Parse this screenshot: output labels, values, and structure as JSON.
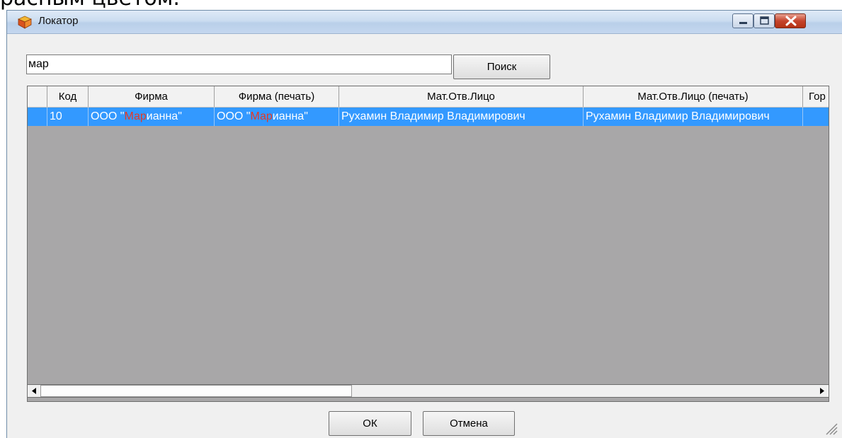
{
  "background_caption": "расным цветом.",
  "window": {
    "title": "Локатор",
    "icon": "box-icon",
    "controls": [
      "minimize-icon",
      "maximize-icon",
      "close-icon"
    ]
  },
  "search": {
    "value": "мар",
    "button_label": "Поиск"
  },
  "grid": {
    "columns": [
      "Код",
      "Фирма",
      "Фирма (печать)",
      "Мат.Отв.Лицо",
      "Мат.Отв.Лицо (печать)",
      "Гор"
    ],
    "rows": [
      {
        "code": "10",
        "firm_prefix": "ООО \"",
        "firm_match": "Мар",
        "firm_suffix": "ианна\"",
        "firm_print_prefix": "ООО \"",
        "firm_print_match": "Мар",
        "firm_print_suffix": "ианна\"",
        "person": "Рухамин Владимир Владимирович",
        "person_print": "Рухамин Владимир Владимирович",
        "city": ""
      }
    ],
    "highlight_color": "#e53924",
    "selection_color": "#3399ff"
  },
  "footer": {
    "ok_label": "ОК",
    "cancel_label": "Отмена"
  }
}
